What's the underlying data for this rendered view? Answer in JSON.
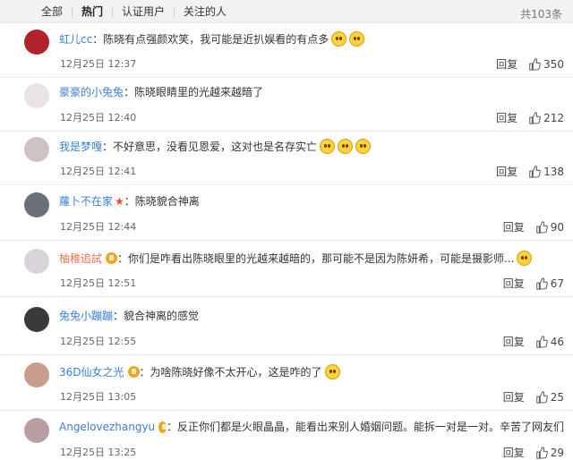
{
  "tabs": [
    "全部",
    "热门",
    "认证用户",
    "关注的人"
  ],
  "active_tab": 1,
  "total_count": "共103条",
  "reply_label": "回复",
  "comments": [
    {
      "user": "虹儿cc",
      "text": "陈晓有点强颜欢笑，我可能是近扒娱看的有点多",
      "time": "12月25日 12:37",
      "likes": "350",
      "user_color": "blue",
      "badge": false,
      "star": false,
      "emojis": 2
    },
    {
      "user": "豪豪的小兔兔",
      "text": "陈晓眼睛里的光越来越暗了",
      "time": "12月25日 12:40",
      "likes": "212",
      "user_color": "blue",
      "badge": false,
      "star": false,
      "emojis": 0
    },
    {
      "user": "我是梦嘎",
      "text": "不好意思，没看见恩爱，这对也是名存实亡",
      "time": "12月25日 12:41",
      "likes": "138",
      "user_color": "blue",
      "badge": false,
      "star": false,
      "emojis": 3
    },
    {
      "user": "蘿卜不在家",
      "text": "陈晓貌合神离",
      "time": "12月25日 12:44",
      "likes": "90",
      "user_color": "blue",
      "badge": false,
      "star": true,
      "emojis": 0
    },
    {
      "user": "柚稚追試",
      "text": "你们是咋看出陈晓眼里的光越来越暗的，那可能不是因为陈妍希，可能是摄影师...",
      "time": "12月25日 12:51",
      "likes": "67",
      "user_color": "orange",
      "badge": true,
      "star": false,
      "emojis": 1
    },
    {
      "user": "兔兔小蹦蹦",
      "text": "貌合神离的感觉",
      "time": "12月25日 12:55",
      "likes": "46",
      "user_color": "blue",
      "badge": false,
      "star": false,
      "emojis": 0
    },
    {
      "user": "36D仙女之光",
      "text": "为啥陈晓好像不太开心，这是咋的了",
      "time": "12月25日 13:05",
      "likes": "25",
      "user_color": "blue",
      "badge": true,
      "star": false,
      "emojis": 1
    },
    {
      "user": "Angelovezhangyu",
      "text": "反正你们都是火眼晶晶，能看出来别人婚姻问题。能拆一对是一对。辛苦了网友们",
      "time": "12月25日 13:25",
      "likes": "29",
      "user_color": "blue",
      "badge": true,
      "star": false,
      "emojis": 0
    }
  ],
  "colors": {
    "user_blue": "#3b7fd6",
    "user_orange": "#eb7350",
    "tab_bg": "#f2f2f5"
  }
}
